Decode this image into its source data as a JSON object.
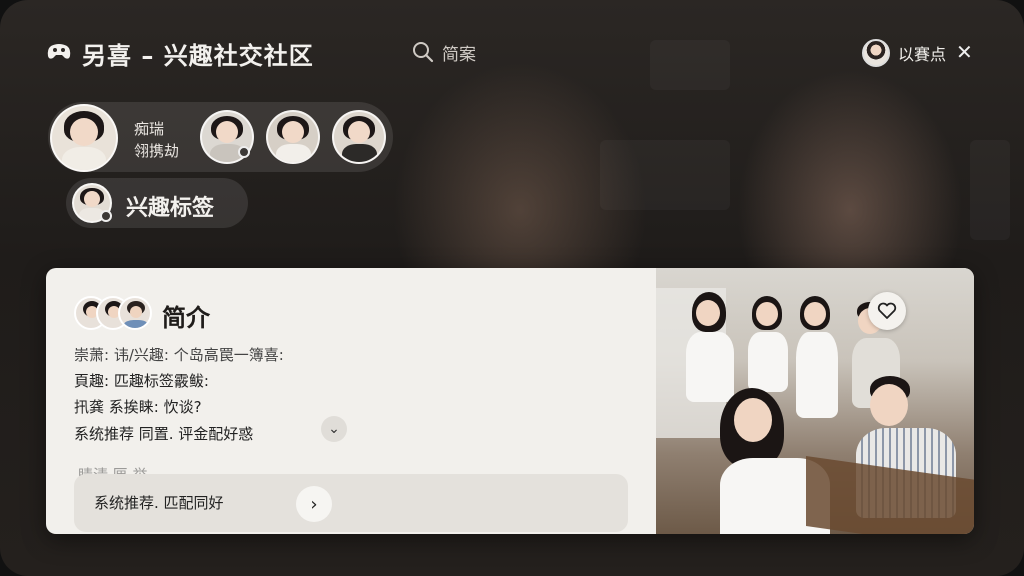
{
  "app": {
    "title": "另喜 – 兴趣社交社区",
    "search_label": "简案",
    "user_label": "以賽点"
  },
  "avatar_row": {
    "label_line1": "痴瑞",
    "label_line2": "翎携劫"
  },
  "interest_tag": {
    "label": "兴趣标签"
  },
  "card": {
    "title": "简介",
    "lines": [
      "崇萧: 讳/兴趣: 个岛高罠一簿喜:",
      "頁趣:  匹趣标签霰鲅:",
      "扟龚    系挨睐: 忺谈?",
      "系统推荐    同置.  评金配好惑"
    ],
    "faded_line": "睛淸    匣    举",
    "recommend": {
      "label": "系统推荐.  匹配同好"
    }
  },
  "icons": {
    "app": "game-controller-icon",
    "search": "search-icon",
    "close": "close-icon",
    "expand": "chevron-down-icon",
    "next": "chevron-right-icon",
    "favorite": "heart-icon"
  },
  "colors": {
    "card_bg": "#f2f0ec",
    "text_light": "#f3f1ee",
    "text_dark": "#1f1c1a"
  }
}
